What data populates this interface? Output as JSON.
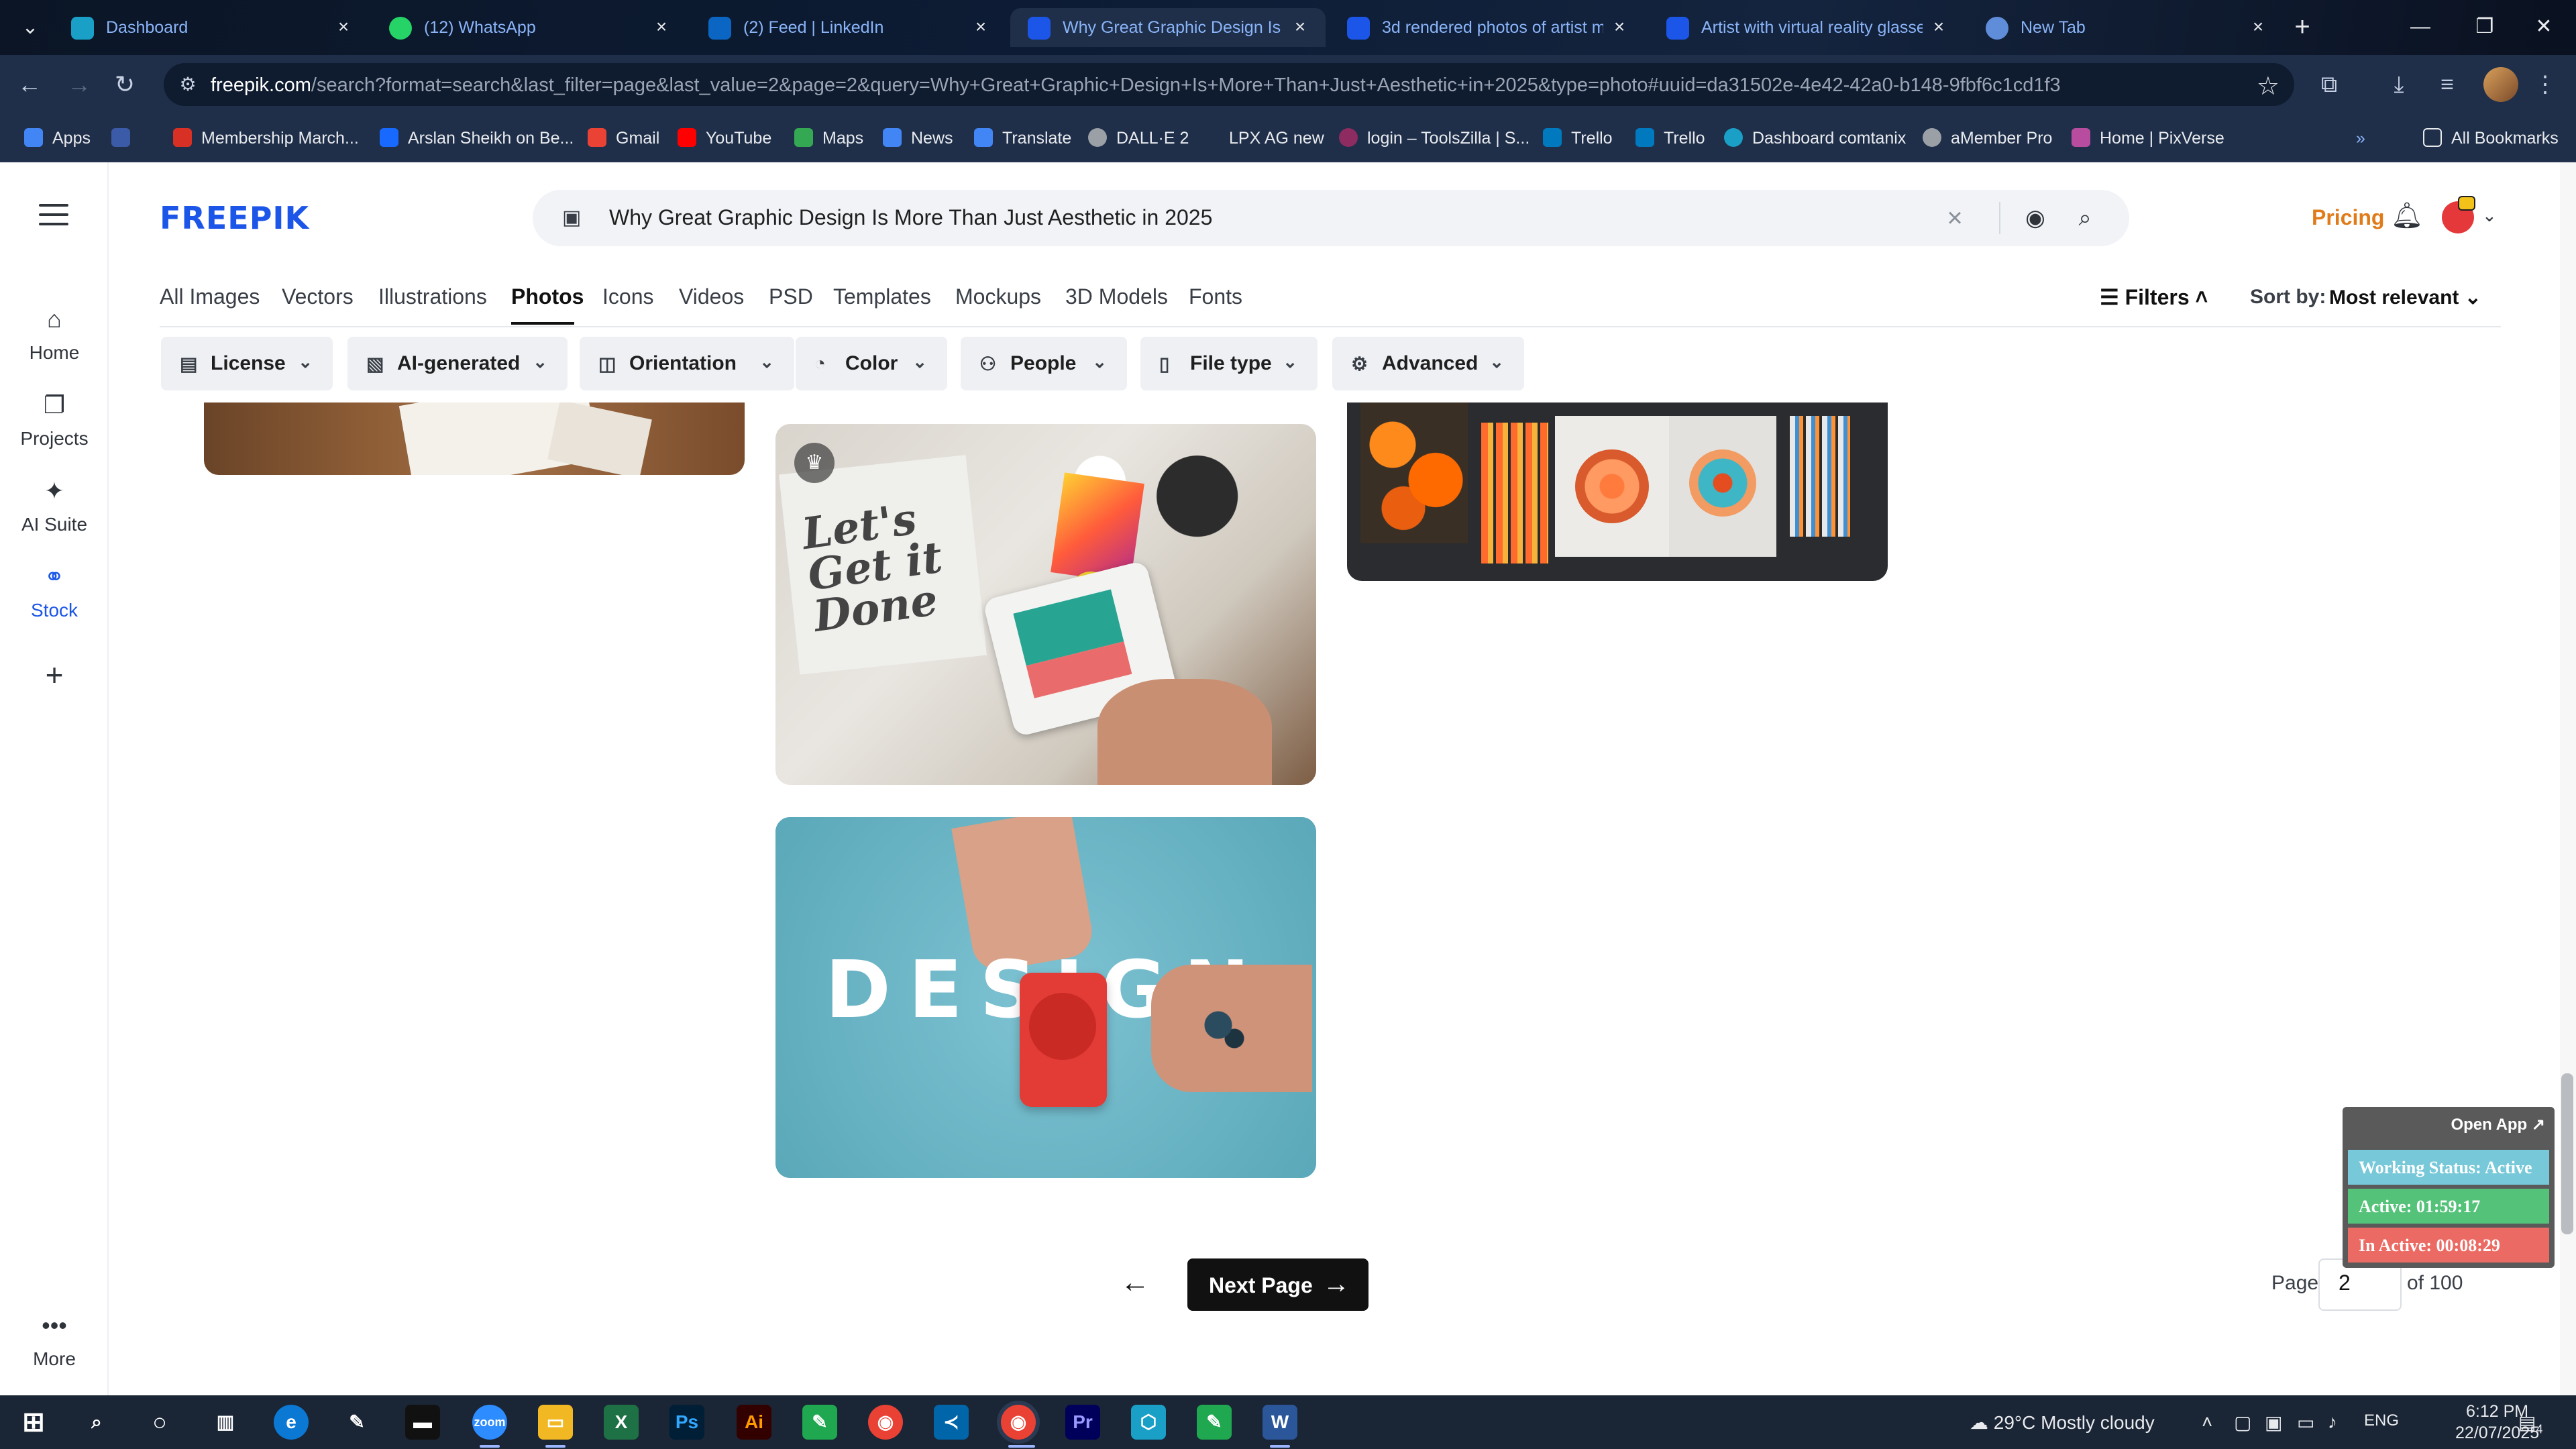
{
  "browser": {
    "tabs": [
      {
        "title": "Dashboard",
        "color": "#1aa0c7",
        "active": false
      },
      {
        "title": "(12) WhatsApp",
        "color": "#25d366",
        "active": false
      },
      {
        "title": "(2) Feed | LinkedIn",
        "color": "#0a66c2",
        "active": false
      },
      {
        "title": "Why Great Graphic Design Is M",
        "color": "#1c56e8",
        "active": true
      },
      {
        "title": "3d rendered photos of artist m",
        "color": "#1c56e8",
        "active": false
      },
      {
        "title": "Artist with virtual reality glasse",
        "color": "#1c56e8",
        "active": false
      },
      {
        "title": "New Tab",
        "color": "#5f8dd9",
        "active": false
      }
    ],
    "url_host": "freepik.com",
    "url_rest": "/search?format=search&last_filter=page&last_value=2&page=2&query=Why+Great+Graphic+Design+Is+More+Than+Just+Aesthetic+in+2025&type=photo#uuid=da31502e-4e42-42a0-b148-9fbf6c1cd1f3",
    "bookmarks": [
      {
        "label": "Apps",
        "color": "#4285f4"
      },
      {
        "label": "Membership March...",
        "color": "#d93025"
      },
      {
        "label": "Arslan Sheikh on Be...",
        "color": "#1769ff"
      },
      {
        "label": "Gmail",
        "color": "#ea4335"
      },
      {
        "label": "YouTube",
        "color": "#ff0000"
      },
      {
        "label": "Maps",
        "color": "#34a853"
      },
      {
        "label": "News",
        "color": "#4285f4"
      },
      {
        "label": "Translate",
        "color": "#4285f4"
      },
      {
        "label": "DALL·E 2",
        "color": "#9aa0a6"
      },
      {
        "label": "LPX AG new",
        "color": "#1f2f4a"
      },
      {
        "label": "login – ToolsZilla | S...",
        "color": "#8e2c61"
      },
      {
        "label": "Trello",
        "color": "#0079bf"
      },
      {
        "label": "Trello",
        "color": "#0079bf"
      },
      {
        "label": "Dashboard comtanix",
        "color": "#1aa0c7"
      },
      {
        "label": "aMember Pro",
        "color": "#9aa0a6"
      },
      {
        "label": "Home | PixVerse",
        "color": "#b84da0"
      }
    ],
    "all_bookmarks": "All Bookmarks"
  },
  "sidebar": {
    "items": [
      {
        "label": "Home",
        "icon": "home-icon"
      },
      {
        "label": "Projects",
        "icon": "projects-icon"
      },
      {
        "label": "AI Suite",
        "icon": "sparkle-icon"
      },
      {
        "label": "Stock",
        "icon": "stock-icon"
      }
    ],
    "more": "More"
  },
  "header": {
    "logo": "FREEPIK",
    "search_query": "Why Great Graphic Design Is More Than Just Aesthetic in 2025",
    "pricing": "Pricing"
  },
  "categories": [
    "All Images",
    "Vectors",
    "Illustrations",
    "Photos",
    "Icons",
    "Videos",
    "PSD",
    "Templates",
    "Mockups",
    "3D Models",
    "Fonts"
  ],
  "active_category": "Photos",
  "filters_label": "Filters",
  "sort": {
    "label": "Sort by:",
    "value": "Most relevant"
  },
  "filter_chips": [
    "License",
    "AI-generated",
    "Orientation",
    "Color",
    "People",
    "File type",
    "Advanced"
  ],
  "pagination": {
    "next_label": "Next Page",
    "page_label": "Page",
    "current": "2",
    "of_label": "of 100"
  },
  "widget": {
    "open_app": "Open App ↗",
    "working_status": "Working Status: Active",
    "active": "Active: 01:59:17",
    "inactive": "In Active: 00:08:29"
  },
  "taskbar": {
    "weather": "29°C  Mostly cloudy",
    "lang": "ENG",
    "time": "6:12 PM",
    "date": "22/07/2025",
    "notif_count": "4"
  }
}
